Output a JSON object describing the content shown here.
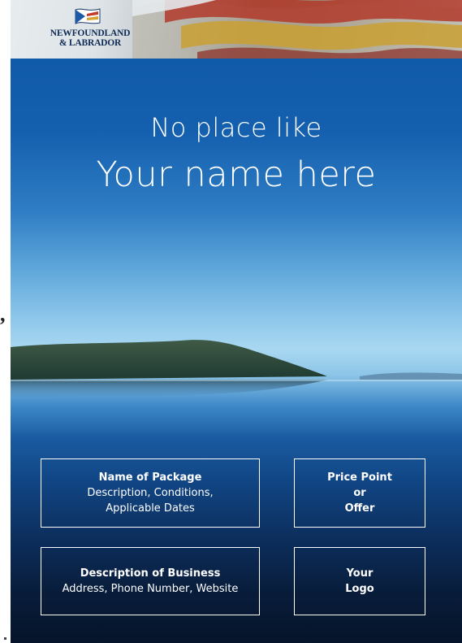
{
  "brand": {
    "line1": "NEWFOUNDLAND",
    "line2": "& LABRADOR"
  },
  "headline": {
    "line1": "No place like",
    "line2": "Your name here"
  },
  "boxes": {
    "package": {
      "title": "Name of Package",
      "line1": "Description, Conditions,",
      "line2": "Applicable Dates"
    },
    "price": {
      "line1": "Price Point",
      "line2": "or",
      "line3": "Offer"
    },
    "business": {
      "title": "Description of Business",
      "line1": "Address, Phone Number, Website"
    },
    "logo": {
      "line1": "Your",
      "line2": "Logo"
    }
  },
  "margin_mark": ",",
  "colors": {
    "sky_top": "#0d56a6",
    "horizon": "#a9d8f1",
    "water_bottom": "#06142a",
    "text": "#ffffff",
    "brand_text": "#0f2b55"
  }
}
